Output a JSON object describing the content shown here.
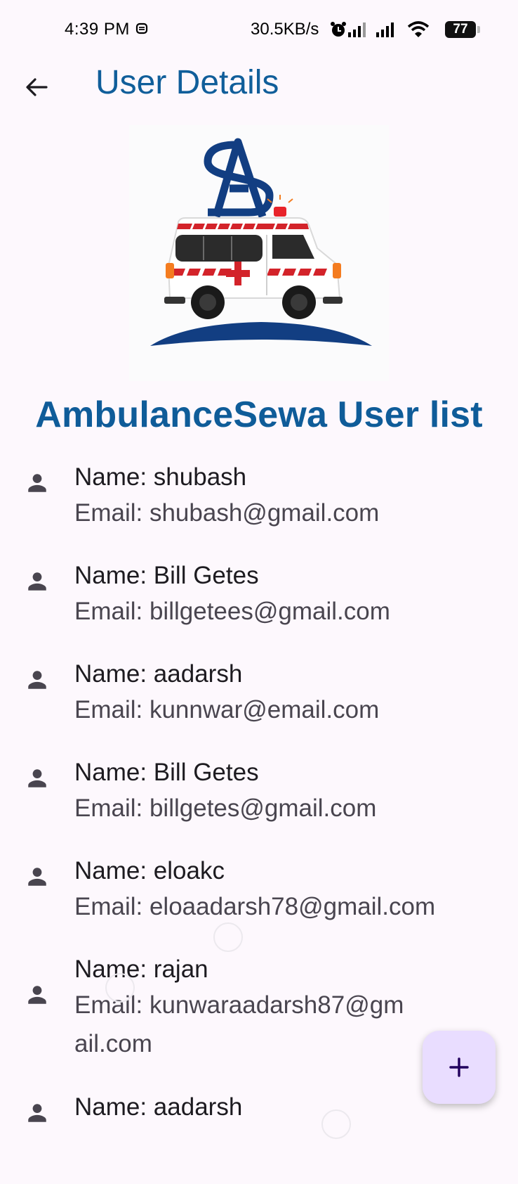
{
  "status_bar": {
    "time": "4:39 PM",
    "network_speed": "30.5KB/s",
    "battery": "77",
    "icons": [
      "sync-icon",
      "alarm-icon",
      "signal-icon",
      "signal-icon",
      "wifi-icon",
      "battery-icon"
    ]
  },
  "app_bar": {
    "title": "User Details",
    "back_icon": "arrow-back-icon"
  },
  "logo": {
    "monogram": "SA",
    "colors": {
      "navy": "#123e82",
      "red": "#d3232a",
      "orange": "#f47c20"
    }
  },
  "list": {
    "heading": "AmbulanceSewa User list",
    "users": [
      {
        "name": "Name: shubash",
        "email": "Email: shubash@gmail.com"
      },
      {
        "name": "Name: Bill Getes",
        "email": "Email: billgetees@gmail.com"
      },
      {
        "name": "Name: aadarsh",
        "email": "Email: kunnwar@email.com"
      },
      {
        "name": "Name: Bill Getes",
        "email": "Email: billgetes@gmail.com"
      },
      {
        "name": "Name: eloakc",
        "email": "Email: eloaadarsh78@gmail.com"
      },
      {
        "name": "Name: rajan",
        "email": "Email: kunwaraadarsh87@gmail.com"
      },
      {
        "name": "Name: aadarsh",
        "email": ""
      }
    ]
  },
  "fab": {
    "icon": "plus-icon",
    "color": "#e9ddff"
  },
  "colors": {
    "title": "#105e9a",
    "heading": "#0f5c99",
    "background": "#fdf8fd"
  }
}
